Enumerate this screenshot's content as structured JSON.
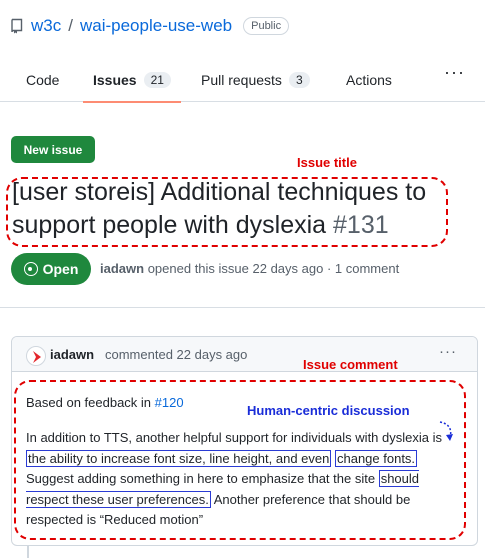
{
  "repo": {
    "owner": "w3c",
    "separator": "/",
    "name": "wai-people-use-web",
    "visibility": "Public"
  },
  "tabs": [
    {
      "label": "Code"
    },
    {
      "label": "Issues",
      "count": "21",
      "active": true
    },
    {
      "label": "Pull requests",
      "count": "3"
    },
    {
      "label": "Actions"
    }
  ],
  "more_menu": "···",
  "new_issue_label": "New issue",
  "annotations": {
    "title_label": "Issue title",
    "comment_label": "Issue comment",
    "discussion_label": "Human-centric discussion",
    "red_color": "#e00000",
    "blue_color": "#1a2dd8"
  },
  "issue": {
    "title": "[user storeis] Additional techniques to support people with dyslexia",
    "number": "#131",
    "state": "Open",
    "author": "iadawn",
    "meta_text": "opened this issue 22 days ago · 1 comment"
  },
  "comment": {
    "author": "iadawn",
    "action_text": "commented 22 days ago",
    "menu": "···",
    "para1_prefix": "Based on feedback in ",
    "para1_link": "#120",
    "para2": {
      "t1": "In addition to TTS, another helpful support for individuals with dyslexia is",
      "h1": "the ability to increase font size, line height, and even",
      "h2": "change fonts.",
      "t2": " Suggest adding something in here to emphasize that the site",
      "h3": "should respect these user preferences.",
      "t3": " Another preference that should be respected is “Reduced motion”"
    }
  },
  "colors": {
    "link": "#0969da",
    "open_green": "#1f883d",
    "tab_underline": "#fd8c73"
  }
}
